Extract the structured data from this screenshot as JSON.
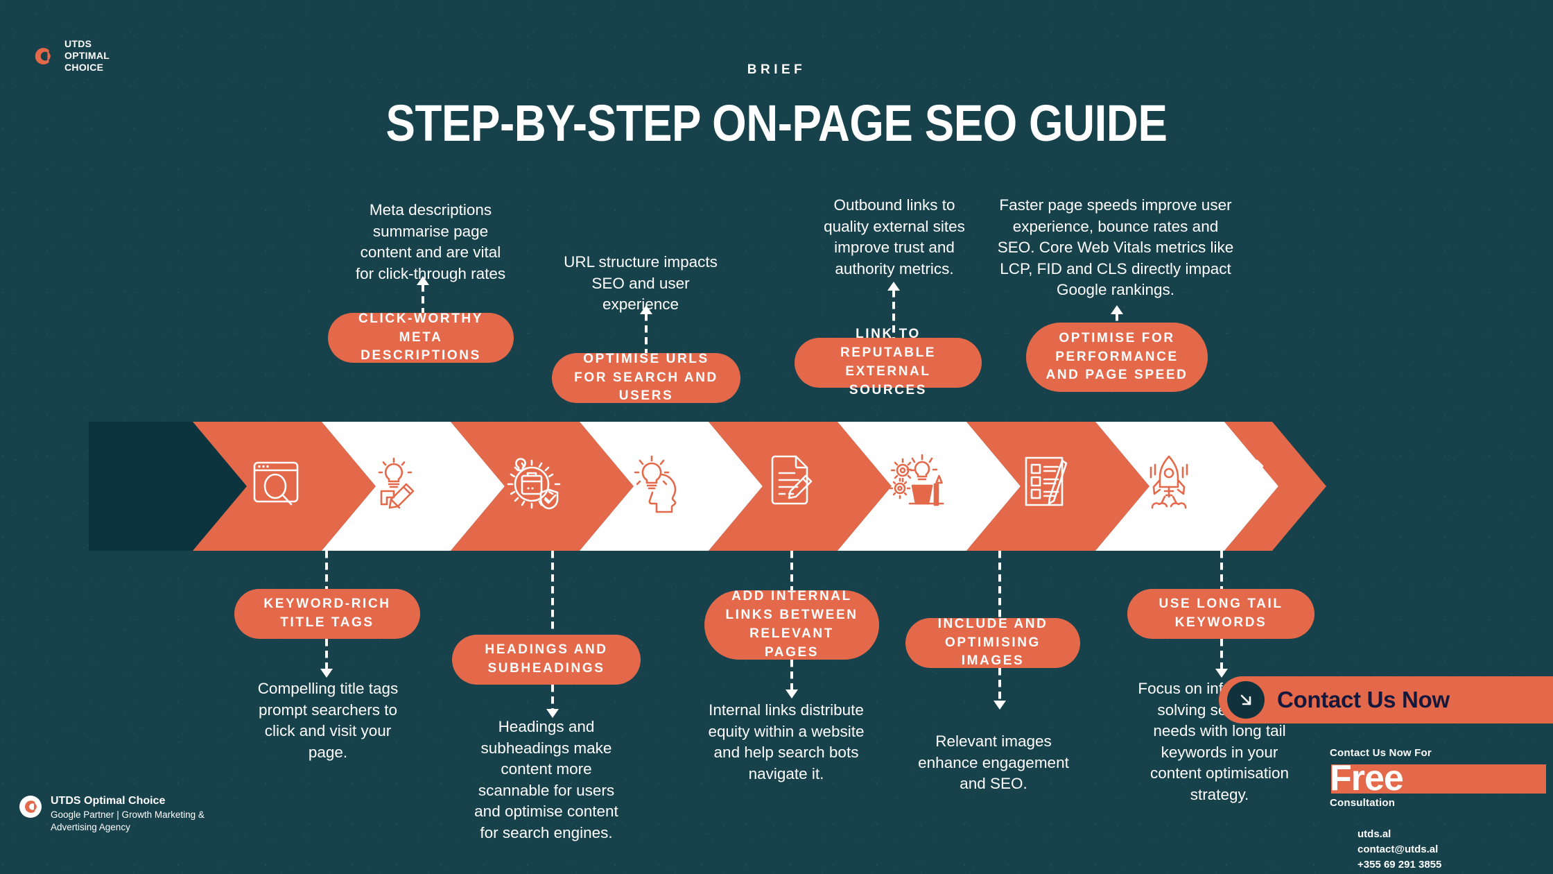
{
  "brand": {
    "top_logo_lines": [
      "UTDS",
      "OPTIMAL",
      "CHOICE"
    ],
    "logo_icon": "utds-circle-logo-icon",
    "footer_name": "UTDS Optimal Choice",
    "footer_desc": "Google Partner | Growth Marketing & Advertising Agency"
  },
  "header": {
    "kicker": "BRIEF",
    "title": "STEP-BY-STEP ON-PAGE SEO GUIDE"
  },
  "colors": {
    "background": "#17414b",
    "accent": "#e4694b",
    "chevron_dark": "#0b343f",
    "text": "#ffffff",
    "cta_text": "#14183c"
  },
  "steps": [
    {
      "index": 1,
      "position": "bottom",
      "icon": "browser-search-icon",
      "pill": "KEYWORD-RICH TITLE TAGS",
      "note": "Compelling title tags prompt searchers to click and visit your page."
    },
    {
      "index": 2,
      "position": "bottom",
      "icon": "lightbulb-pencil-icon",
      "pill": "HEADINGS AND SUBHEADINGS",
      "note": "Headings and subheadings make content more scannable for users and optimise content for search engines."
    },
    {
      "index": 3,
      "position": "top",
      "icon": "gear-box-check-icon",
      "pill": "CLICK-WORTHY META DESCRIPTIONS",
      "note": "Meta descriptions summarise page content and are vital for click-through rates"
    },
    {
      "index": 4,
      "position": "top",
      "icon": "head-lightbulb-icon",
      "pill": "OPTIMISE URLS FOR SEARCH AND USERS",
      "note": "URL structure impacts SEO and user experience"
    },
    {
      "index": 5,
      "position": "bottom",
      "icon": "document-pencil-icon",
      "pill": "ADD INTERNAL LINKS BETWEEN RELEVANT PAGES",
      "note": "Internal links distribute equity within a website and help search bots navigate it."
    },
    {
      "index": 6,
      "position": "top",
      "icon": "gears-idea-desk-icon",
      "pill": "LINK TO REPUTABLE EXTERNAL SOURCES",
      "note": "Outbound links to quality external sites improve trust and authority metrics."
    },
    {
      "index": 7,
      "position": "bottom",
      "icon": "checklist-pencil-icon",
      "pill": "INCLUDE AND OPTIMISING IMAGES",
      "note": "Relevant images enhance engagement and SEO."
    },
    {
      "index": 8,
      "position": "top",
      "icon": "rocket-launch-icon",
      "pill": "OPTIMISE FOR PERFORMANCE AND PAGE SPEED",
      "note": "Faster page speeds improve user experience, bounce rates and SEO. Core Web Vitals metrics like LCP, FID and CLS directly impact Google rankings."
    },
    {
      "index": 9,
      "position": "bottom",
      "icon": "wrench-screwdriver-icon",
      "pill": "USE LONG TAIL KEYWORDS",
      "note": "Focus on informing and solving searchers' needs with long tail keywords in your content optimisation strategy."
    }
  ],
  "cta": {
    "button_label": "Contact Us Now",
    "button_icon": "arrow-down-right-icon",
    "promo_line1": "Contact Us Now For",
    "promo_highlight": "Free",
    "promo_line3": "Consultation",
    "website": "utds.al",
    "email": "contact@utds.al",
    "phone": "+355 69 291 3855"
  }
}
